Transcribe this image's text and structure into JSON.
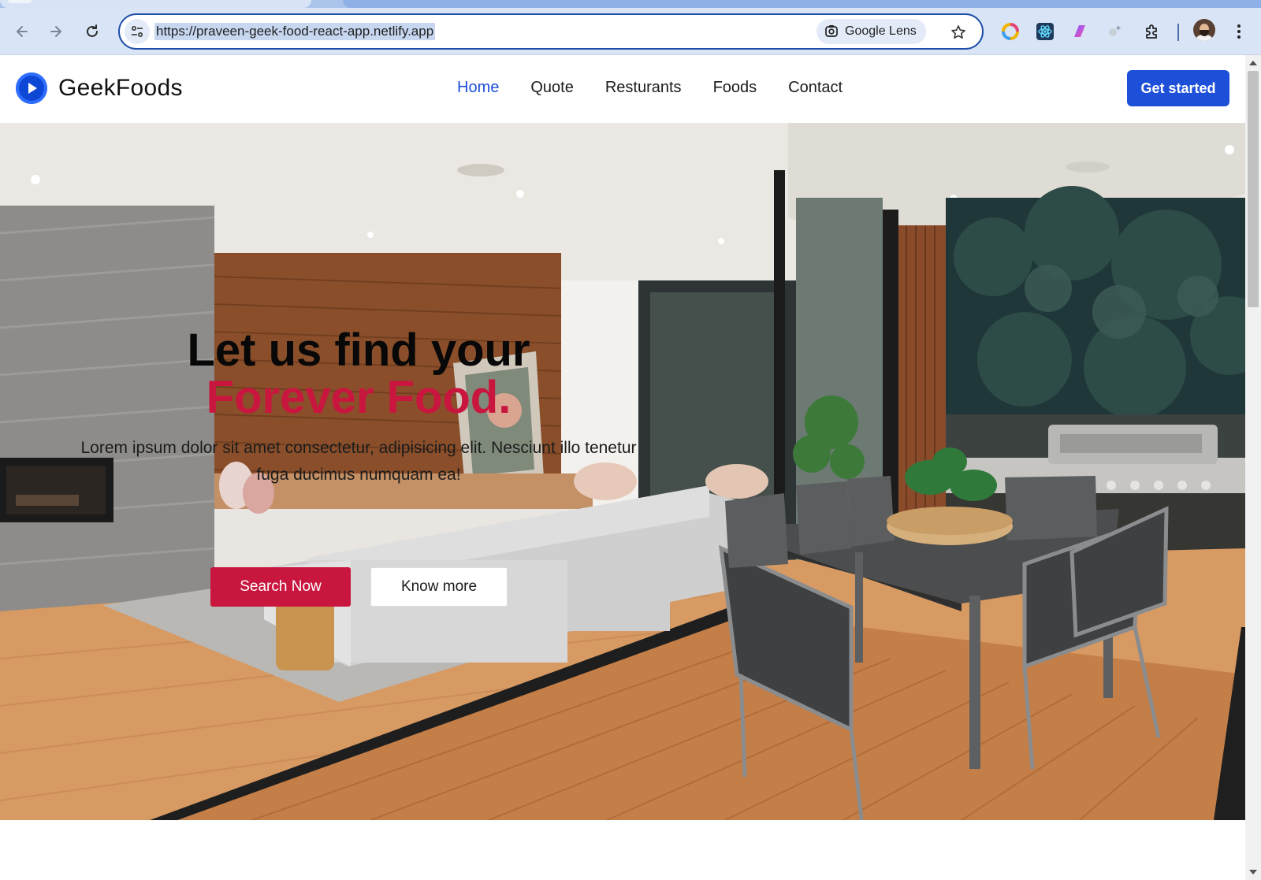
{
  "browser": {
    "url": "https://praveen-geek-food-react-app.netlify.app",
    "lens_label": "Google Lens",
    "extensions": [
      "color-wheel-icon",
      "react-devtools-icon",
      "gradient-extension-icon",
      "sparkle-extension-icon",
      "puzzle-icon"
    ]
  },
  "site": {
    "brand": "GeekFoods",
    "nav": [
      "Home",
      "Quote",
      "Resturants",
      "Foods",
      "Contact"
    ],
    "active_nav": "Home",
    "cta_label": "Get started"
  },
  "hero": {
    "title_line1": "Let us find your",
    "title_line2": "Forever Food.",
    "lead": "Lorem ipsum dolor sit amet consectetur, adipisicing elit. Nesciunt illo tenetur fuga ducimus numquam ea!",
    "primary_button": "Search Now",
    "secondary_button": "Know more"
  },
  "colors": {
    "brand_blue": "#1d4fd8",
    "accent_red": "#c8163f",
    "chrome_bg": "#d9e5f6"
  }
}
